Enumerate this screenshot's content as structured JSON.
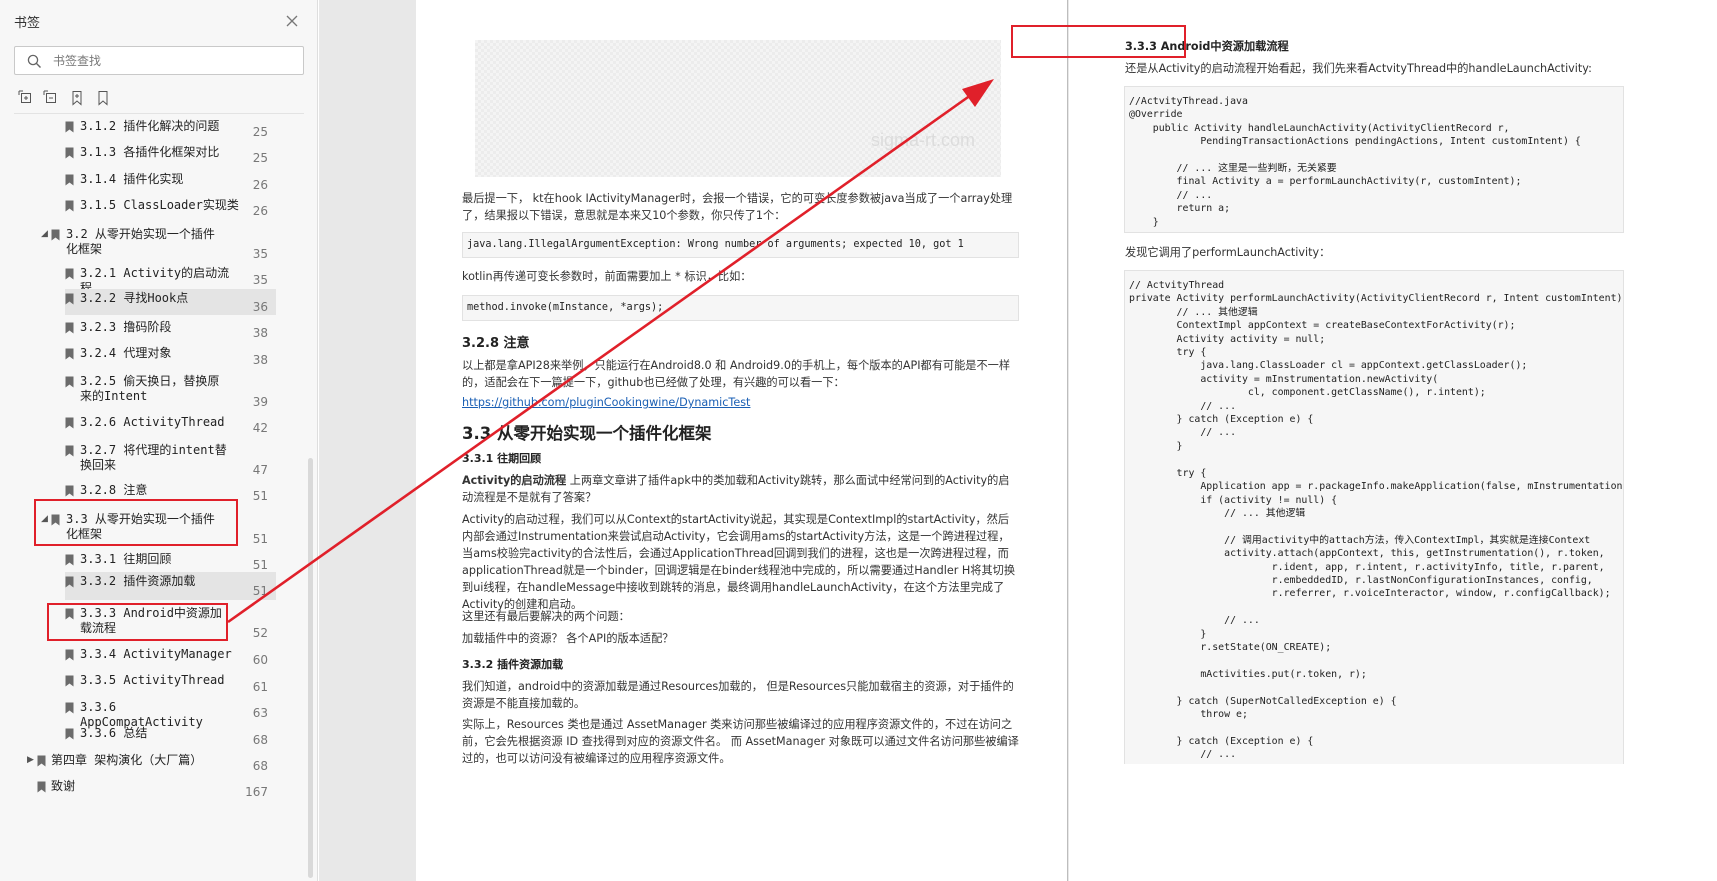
{
  "sidebar": {
    "title": "书签",
    "search_placeholder": "书签查找",
    "tools": [
      "expand-all-icon",
      "collapse-all-icon",
      "add-bookmark-icon",
      "bookmark-properties-icon"
    ]
  },
  "bookmarks": [
    {
      "label": "3.1.2 插件化解决的问题",
      "page": "25"
    },
    {
      "label": "3.1.3 各插件化框架对比",
      "page": "25"
    },
    {
      "label": "3.1.4 插件化实现",
      "page": "26"
    },
    {
      "label": "3.1.5 ClassLoader实现类",
      "page": "26"
    },
    {
      "label": "3.2 从零开始实现一个插件化框架",
      "page": "35"
    },
    {
      "label": "3.2.1 Activity的启动流程",
      "page": "35"
    },
    {
      "label": "3.2.2 寻找Hook点",
      "page": "36"
    },
    {
      "label": "3.2.3 撸码阶段",
      "page": "38"
    },
    {
      "label": "3.2.4 代理对象",
      "page": "38"
    },
    {
      "label": "3.2.5 偷天换日，替换原来的Intent",
      "page": "39"
    },
    {
      "label": "3.2.6 ActivityThread",
      "page": "42"
    },
    {
      "label": "3.2.7 将代理的intent替换回来",
      "page": "47"
    },
    {
      "label": "3.2.8 注意",
      "page": "51"
    },
    {
      "label": "3.3 从零开始实现一个插件化框架",
      "page": "51"
    },
    {
      "label": "3.3.1 往期回顾",
      "page": "51"
    },
    {
      "label": "3.3.2 插件资源加载",
      "page": "51"
    },
    {
      "label": "3.3.3 Android中资源加载流程",
      "page": "52"
    },
    {
      "label": "3.3.4 ActivityManager",
      "page": "60"
    },
    {
      "label": "3.3.5 ActivityThread",
      "page": "61"
    },
    {
      "label": "3.3.6 AppCompatActivity",
      "page": "63"
    },
    {
      "label": "3.3.6 总结",
      "page": "68"
    },
    {
      "label": "第四章 架构演化（大厂篇）",
      "page": "68"
    },
    {
      "label": "致谢",
      "page": "167"
    }
  ],
  "left_page": {
    "image_watermark": "sigma-rt.com",
    "p1": "最后提一下， kt在hook IActivityManager时，会报一个错误，它的可变长度参数被java当成了一个array处理了，结果报以下错误，意思就是本来又10个参数，你只传了1个：",
    "code1": "java.lang.IllegalArgumentException: Wrong number of arguments; expected 10, got 1",
    "p2": "kotlin再传递可变长参数时，前面需要加上 * 标识，比如：",
    "code2": "method.invoke(mInstance, *args);",
    "h_328": "3.2.8 注意",
    "p3": "以上都是拿API28来举例，只能运行在Android8.0 和 Android9.0的手机上，每个版本的API都有可能是不一样的，适配会在下一篇提一下，github也已经做了处理，有兴趣的可以看一下：",
    "link": "https://github.com/pluginCookingwine/DynamicTest",
    "h_33": "3.3 从零开始实现一个插件化框架",
    "h_331": "3.3.1 往期回顾",
    "p4_bold": "Activity的启动流程",
    "p4": " 上两章文章讲了插件apk中的类加载和Activity跳转，那么面试中经常问到的Activity的启动流程是不是就有了答案？",
    "p5": "Activity的启动过程，我们可以从Context的startActivity说起，其实现是ContextImpl的startActivity，然后内部会通过Instrumentation来尝试启动Activity，它会调用ams的startActivity方法，这是一个跨进程过程，当ams校验完activity的合法性后，会通过ApplicationThread回调到我们的进程，这也是一次跨进程过程，而applicationThread就是一个binder，回调逻辑是在binder线程池中完成的，所以需要通过Handler H将其切换到ui线程，在handleMessage中接收到跳转的消息，最终调用handleLaunchActivity，在这个方法里完成了Activity的创建和启动。",
    "p6": "这里还有最后要解决的两个问题：",
    "p7": "加载插件中的资源？ 各个API的版本适配？",
    "h_332": "3.3.2 插件资源加载",
    "p8": "我们知道，android中的资源加载是通过Resources加载的， 但是Resources只能加载宿主的资源，对于插件的资源是不能直接加载的。",
    "p9": "实际上，Resources 类也是通过 AssetManager 类来访问那些被编译过的应用程序资源文件的，不过在访问之前，它会先根据资源 ID 查找得到对应的资源文件名。 而 AssetManager 对象既可以通过文件名访问那些被编译过的，也可以访问没有被编译过的应用程序资源文件。"
  },
  "right_page": {
    "h_333": "3.3.3 Android中资源加载流程",
    "p1": "还是从Activity的启动流程开始看起，我们先来看ActvityThread中的handleLaunchActivity:",
    "code1": "//ActvityThread.java\n@Override\n    public Activity handleLaunchActivity(ActivityClientRecord r,\n            PendingTransactionActions pendingActions, Intent customIntent) {\n\n        // ... 这里是一些判断，无关紧要\n        final Activity a = performLaunchActivity(r, customIntent);\n        // ...\n        return a;\n    }",
    "p2": "发现它调用了performLaunchActivity：",
    "code2": "// ActvityThread\nprivate Activity performLaunchActivity(ActivityClientRecord r, Intent customIntent) {\n        // ... 其他逻辑\n        ContextImpl appContext = createBaseContextForActivity(r);\n        Activity activity = null;\n        try {\n            java.lang.ClassLoader cl = appContext.getClassLoader();\n            activity = mInstrumentation.newActivity(\n                    cl, component.getClassName(), r.intent);\n            // ...\n        } catch (Exception e) {\n            // ...\n        }\n\n        try {\n            Application app = r.packageInfo.makeApplication(false, mInstrumentation);\n            if (activity != null) {\n                // ... 其他逻辑\n\n                // 调用activity中的attach方法，传入ContextImpl，其实就是连接Context\n                activity.attach(appContext, this, getInstrumentation(), r.token,\n                        r.ident, app, r.intent, r.activityInfo, title, r.parent,\n                        r.embeddedID, r.lastNonConfigurationInstances, config,\n                        r.referrer, r.voiceInteractor, window, r.configCallback);\n\n                // ...\n            }\n            r.setState(ON_CREATE);\n\n            mActivities.put(r.token, r);\n\n        } catch (SuperNotCalledException e) {\n            throw e;\n\n        } catch (Exception e) {\n            // ..."
  },
  "colors": {
    "annotation": "#e0202a",
    "sidebar_bg": "#f7f7f7",
    "selected_row": "#e4e4e4",
    "link": "#1a5fb4"
  }
}
